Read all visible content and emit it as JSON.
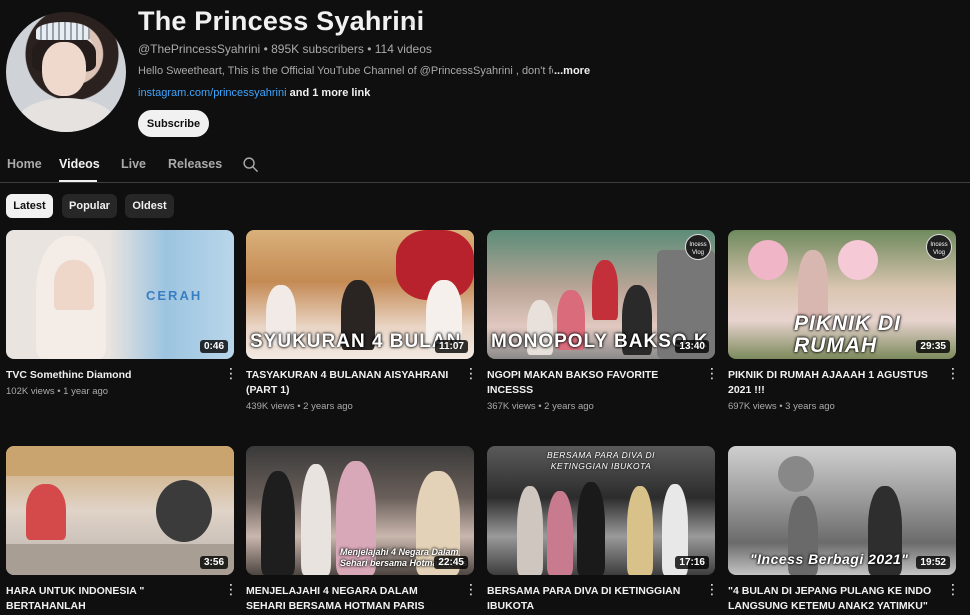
{
  "channel": {
    "name": "The Princess Syahrini",
    "handle": "@ThePrincessSyahrini",
    "subscribers": "895K subscribers",
    "videos_count": "114 videos",
    "description": "Hello Sweetheart, This is the Official YouTube Channel of @PrincessSyahrini , don't forget t",
    "more_label": "...more",
    "link_text": "instagram.com/princessyahrini",
    "more_links": "and 1 more link",
    "subscribe_label": "Subscribe",
    "verified_glyph": "♪"
  },
  "tabs": [
    {
      "label": "Home",
      "active": false
    },
    {
      "label": "Videos",
      "active": true
    },
    {
      "label": "Live",
      "active": false
    },
    {
      "label": "Releases",
      "active": false
    }
  ],
  "sort_chips": [
    {
      "label": "Latest",
      "active": true
    },
    {
      "label": "Popular",
      "active": false
    },
    {
      "label": "Oldest",
      "active": false
    }
  ],
  "videos": [
    {
      "title": "TVC Somethinc Diamond",
      "meta": "102K views • 1 year ago",
      "duration": "0:46",
      "overlay": "",
      "thumb_text": "CERAH"
    },
    {
      "title": "TASYAKURAN 4 BULANAN AISYAHRANI (PART 1)",
      "meta": "439K views • 2 years ago",
      "duration": "11:07",
      "overlay": "SYUKURAN 4 BULAN"
    },
    {
      "title": "NGOPI MAKAN BAKSO FAVORITE INCESSS",
      "meta": "367K views • 2 years ago",
      "duration": "13:40",
      "overlay": "MONOPOLY BAKSO K"
    },
    {
      "title": "PIKNIK DI RUMAH AJAAAH 1 AGUSTUS 2021 !!!",
      "meta": "697K views • 3 years ago",
      "duration": "29:35",
      "overlay": "PIKNIK DI RUMAH"
    },
    {
      "title": "HARA UNTUK INDONESIA \" BERTAHANLAH",
      "meta": "",
      "duration": "3:56",
      "overlay": ""
    },
    {
      "title": "MENJELAJAHI 4 NEGARA DALAM SEHARI BERSAMA HOTMAN PARIS",
      "meta": "",
      "duration": "22:45",
      "overlay": "Menjelajahi 4 Negara Dalam Sehari bersama Hotman Paris"
    },
    {
      "title": "BERSAMA PARA DIVA DI KETINGGIAN IBUKOTA",
      "meta": "",
      "duration": "17:16",
      "overlay": "BERSAMA PARA DIVA DI KETINGGIAN IBUKOTA"
    },
    {
      "title": "\"4 BULAN DI JEPANG PULANG KE INDO LANGSUNG KETEMU ANAK2 YATIMKU\"",
      "meta": "",
      "duration": "19:52",
      "overlay": "\"Incess Berbagi 2021\""
    }
  ],
  "vlog_badge_text": "Incess Vlog"
}
